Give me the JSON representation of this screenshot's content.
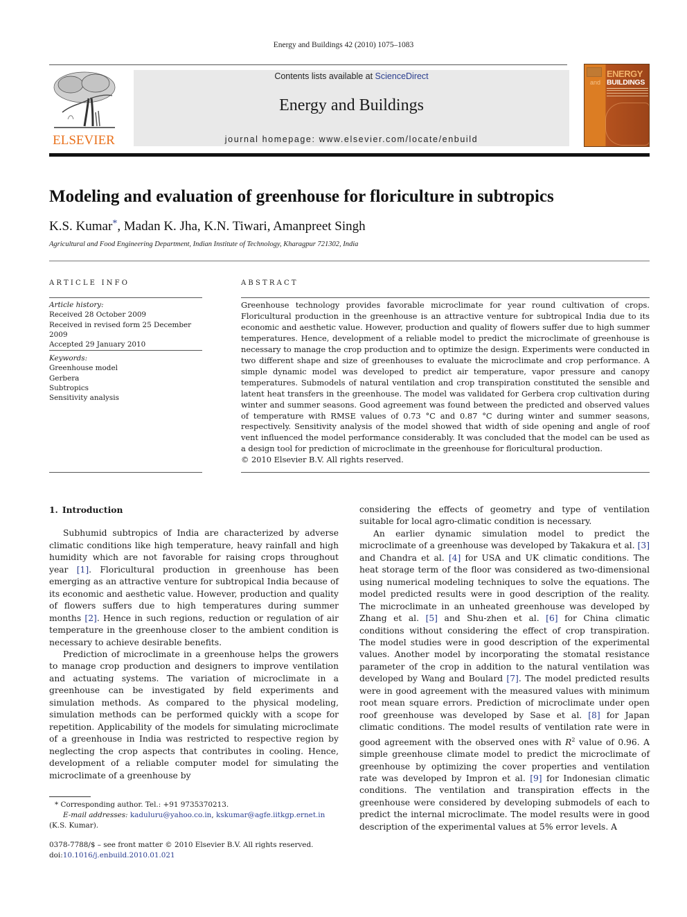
{
  "running_head": "Energy and Buildings 42 (2010) 1075–1083",
  "header": {
    "publisher_logo_text": "ELSEVIER",
    "contents_prefix": "Contents lists available at ",
    "contents_link": "ScienceDirect",
    "journal_name": "Energy and Buildings",
    "homepage_label": "journal homepage: ",
    "homepage_url": "www.elsevier.com/locate/enbuild",
    "cover": {
      "title_line1": "ENERGY",
      "title_and": "and",
      "title_line2": "BUILDINGS",
      "colors": {
        "orange": "#dc7d23",
        "rust": "#b5521e"
      }
    }
  },
  "article": {
    "title": "Modeling and evaluation of greenhouse for floriculture in subtropics",
    "authors_first": "K.S. Kumar",
    "corresponding_mark": "*",
    "authors_rest": ", Madan K. Jha, K.N. Tiwari, Amanpreet Singh",
    "affiliation": "Agricultural and Food Engineering Department, Indian Institute of Technology, Kharagpur 721302, India"
  },
  "article_info": {
    "heading": "ARTICLE INFO",
    "history_label": "Article history:",
    "history": [
      "Received 28 October 2009",
      "Received in revised form 25 December 2009",
      "Accepted 29 January 2010"
    ],
    "keywords_label": "Keywords:",
    "keywords": [
      "Greenhouse model",
      "Gerbera",
      "Subtropics",
      "Sensitivity analysis"
    ]
  },
  "abstract": {
    "heading": "ABSTRACT",
    "text": "Greenhouse technology provides favorable microclimate for year round cultivation of crops. Floricultural production in the greenhouse is an attractive venture for subtropical India due to its economic and aesthetic value. However, production and quality of flowers suffer due to high summer temperatures. Hence, development of a reliable model to predict the microclimate of greenhouse is necessary to manage the crop production and to optimize the design. Experiments were conducted in two different shape and size of greenhouses to evaluate the microclimate and crop performance. A simple dynamic model was developed to predict air temperature, vapor pressure and canopy temperatures. Submodels of natural ventilation and crop transpiration constituted the sensible and latent heat transfers in the greenhouse. The model was validated for Gerbera crop cultivation during winter and summer seasons. Good agreement was found between the predicted and observed values of temperature with RMSE values of 0.73 °C and 0.87 °C during winter and summer seasons, respectively. Sensitivity analysis of the model showed that width of side opening and angle of roof vent influenced the model performance considerably. It was concluded that the model can be used as a design tool for prediction of microclimate in the greenhouse for floricultural production.",
    "copyright": "© 2010 Elsevier B.V. All rights reserved."
  },
  "introduction": {
    "number": "1.",
    "heading": "Introduction",
    "p1": {
      "a": "Subhumid subtropics of India are characterized by adverse climatic conditions like high temperature, heavy rainfall and high humidity which are not favorable for raising crops throughout year ",
      "ref1": "[1]",
      "b": ". Floricultural production in greenhouse has been emerging as an attractive venture for subtropical India because of its economic and aesthetic value. However, production and quality of flowers suffers due to high temperatures during summer months ",
      "ref2": "[2]",
      "c": ". Hence in such regions, reduction or regulation of air temperature in the greenhouse closer to the ambient condition is necessary to achieve desirable benefits."
    },
    "p2": "Prediction of microclimate in a greenhouse helps the growers to manage crop production and designers to improve ventilation and actuating systems. The variation of microclimate in a greenhouse can be investigated by field experiments and simulation methods. As compared to the physical modeling, simulation methods can be performed quickly with a scope for repetition. Applicability of the models for simulating microclimate of a greenhouse in India was restricted to respective region by neglecting the crop aspects that contributes in cooling. Hence, development of a reliable computer model for simulating the microclimate of a greenhouse by",
    "p2_cont": "considering the effects of geometry and type of ventilation suitable for local agro-climatic condition is necessary.",
    "p3": {
      "a": "An earlier dynamic simulation model to predict the microclimate of a greenhouse was developed by Takakura et al. ",
      "ref3": "[3]",
      "b": " and Chandra et al. ",
      "ref4": "[4]",
      "c": " for USA and UK climatic conditions. The heat storage term of the floor was considered as two-dimensional using numerical modeling techniques to solve the equations. The model predicted results were in good description of the reality. The microclimate in an unheated greenhouse was developed by Zhang et al. ",
      "ref5": "[5]",
      "d": " and Shu-zhen et al. ",
      "ref6": "[6]",
      "e": " for China climatic conditions without considering the effect of crop transpiration. The model studies were in good description of the experimental values. Another model by incorporating the stomatal resistance parameter of the crop in addition to the natural ventilation was developed by Wang and Boulard ",
      "ref7": "[7]",
      "f": ". The model predicted results were in good agreement with the measured values with minimum root mean square errors. Prediction of microclimate under open roof greenhouse was developed by Sase et al. ",
      "ref8": "[8]",
      "g": " for Japan climatic conditions. The model results of ventilation rate were in good agreement with the observed ones with ",
      "r_sym": "R",
      "r_sup": "2",
      "h": " value of 0.96. A simple greenhouse climate model to predict the microclimate of greenhouse by optimizing the cover properties and ventilation rate was developed by Impron et al. ",
      "ref9": "[9]",
      "i": " for Indonesian climatic conditions. The ventilation and transpiration effects in the greenhouse were considered by developing submodels of each to predict the internal microclimate. The model results were in good description of the experimental values at 5% error levels. A"
    }
  },
  "footnote": {
    "mark": "*",
    "corresponding": "Corresponding author. Tel.: +91 9735370213.",
    "email_label": "E-mail addresses:",
    "email1": "kaduluru@yahoo.co.in",
    "email_sep": ", ",
    "email2": "kskumar@agfe.iitkgp.ernet.in",
    "owner": "(K.S. Kumar)."
  },
  "front_matter": {
    "issn_line": "0378-7788/$ – see front matter © 2010 Elsevier B.V. All rights reserved.",
    "doi_label": "doi:",
    "doi": "10.1016/j.enbuild.2010.01.021"
  }
}
